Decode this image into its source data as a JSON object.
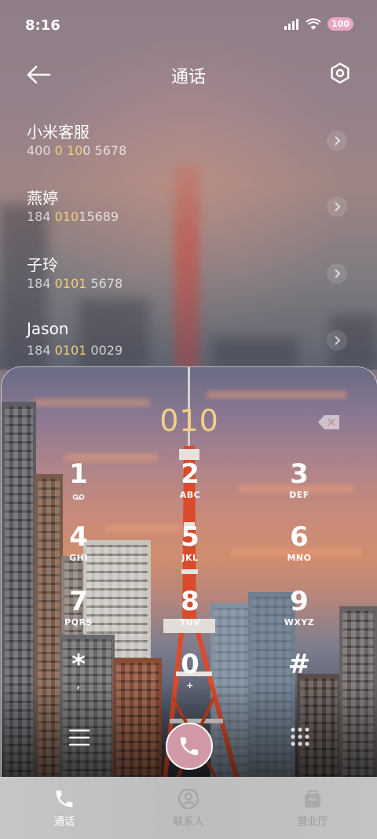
{
  "status": {
    "time": "8:16",
    "battery": "100"
  },
  "header": {
    "title": "通话"
  },
  "contacts": [
    {
      "name": "小米客服",
      "num_a": "400 ",
      "num_hl": "0",
      "num_b": " ",
      "num_hl2": "10",
      "num_c": "0 5678"
    },
    {
      "name": "燕婷",
      "num_a": "184 ",
      "num_hl": "010",
      "num_b": "",
      "num_hl2": "",
      "num_c": "15689"
    },
    {
      "name": "子玲",
      "num_a": "184 ",
      "num_hl": "0101",
      "num_b": "",
      "num_hl2": "",
      "num_c": " 5678"
    },
    {
      "name": "Jason",
      "num_a": "184 ",
      "num_hl": "0101",
      "num_b": "",
      "num_hl2": "",
      "num_c": " 0029"
    }
  ],
  "dialer": {
    "input": "010",
    "keys": [
      {
        "digit": "1",
        "letters": ""
      },
      {
        "digit": "2",
        "letters": "ABC"
      },
      {
        "digit": "3",
        "letters": "DEF"
      },
      {
        "digit": "4",
        "letters": "GHI"
      },
      {
        "digit": "5",
        "letters": "JKL"
      },
      {
        "digit": "6",
        "letters": "MNO"
      },
      {
        "digit": "7",
        "letters": "PQRS"
      },
      {
        "digit": "8",
        "letters": "TUV"
      },
      {
        "digit": "9",
        "letters": "WXYZ"
      },
      {
        "digit": "*",
        "letters": ","
      },
      {
        "digit": "0",
        "letters": "+"
      },
      {
        "digit": "#",
        "letters": ""
      }
    ],
    "voicemail_icon": "voicemail-icon"
  },
  "tabs": [
    {
      "label": "通话",
      "icon": "phone-icon",
      "active": true
    },
    {
      "label": "联系人",
      "icon": "person-icon",
      "active": false
    },
    {
      "label": "营业厅",
      "icon": "store-icon",
      "active": false
    }
  ],
  "colors": {
    "accent": "#f3cf86",
    "call_button": "#d199a7",
    "tab_active": "#ffffff",
    "tab_inactive": "#9a9a9a"
  }
}
